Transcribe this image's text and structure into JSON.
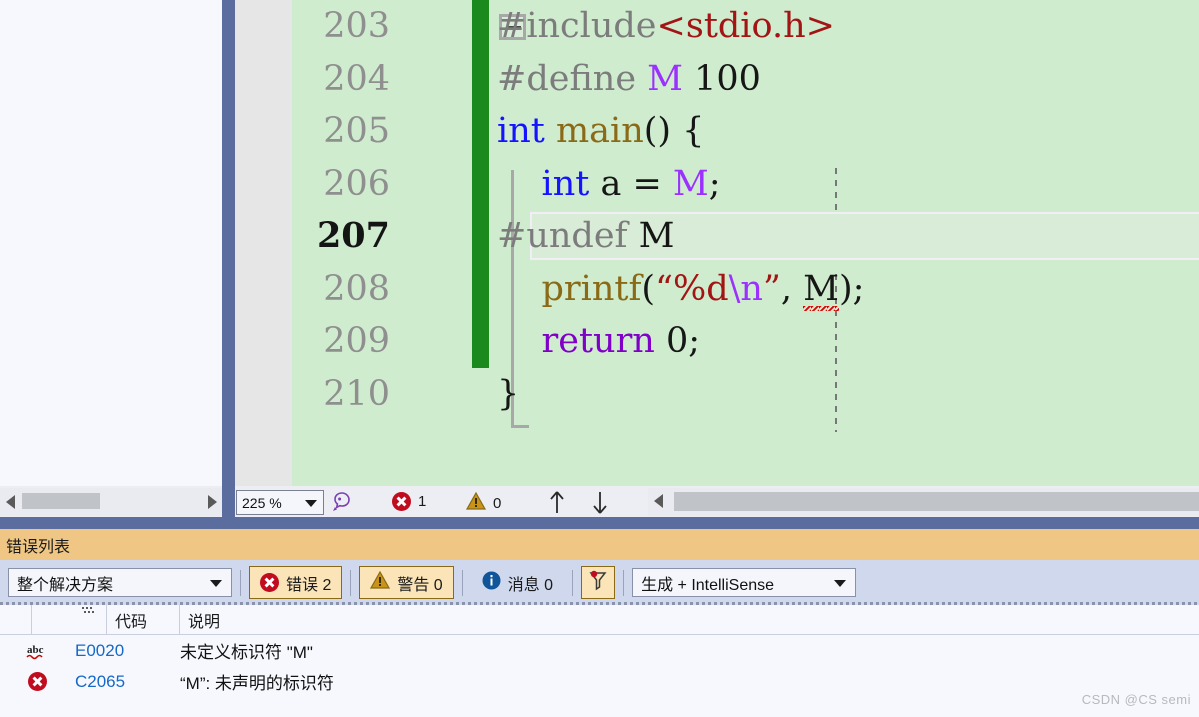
{
  "editor": {
    "zoom_level": "225 %",
    "error_count": "1",
    "warning_count": "0",
    "lines": [
      {
        "num": "203",
        "current": false,
        "tokens": [
          {
            "t": "#include",
            "c": "tok-pp"
          },
          {
            "t": "<stdio.h>",
            "c": "tok-str"
          }
        ]
      },
      {
        "num": "204",
        "current": false,
        "tokens": [
          {
            "t": "#define ",
            "c": "tok-pp"
          },
          {
            "t": "M",
            "c": "tok-macro"
          },
          {
            "t": " 100",
            "c": "tok-plain"
          }
        ]
      },
      {
        "num": "205",
        "current": false,
        "tokens": [
          {
            "t": "int",
            "c": "tok-kw"
          },
          {
            "t": " ",
            "c": "tok-plain"
          },
          {
            "t": "main",
            "c": "tok-fn"
          },
          {
            "t": "() {",
            "c": "tok-plain"
          }
        ]
      },
      {
        "num": "206",
        "current": false,
        "tokens": [
          {
            "t": "    ",
            "c": "tok-plain"
          },
          {
            "t": "int",
            "c": "tok-kw"
          },
          {
            "t": " a = ",
            "c": "tok-plain"
          },
          {
            "t": "M",
            "c": "tok-macro"
          },
          {
            "t": ";",
            "c": "tok-plain"
          }
        ]
      },
      {
        "num": "207",
        "current": true,
        "tokens": [
          {
            "t": "#undef ",
            "c": "tok-pp"
          },
          {
            "t": "M",
            "c": "tok-plain"
          }
        ]
      },
      {
        "num": "208",
        "current": false,
        "tokens": [
          {
            "t": "    ",
            "c": "tok-plain"
          },
          {
            "t": "printf",
            "c": "tok-fn"
          },
          {
            "t": "(",
            "c": "tok-plain"
          },
          {
            "t": "“%d",
            "c": "tok-str"
          },
          {
            "t": "\\n",
            "c": "tok-esc"
          },
          {
            "t": "”",
            "c": "tok-str"
          },
          {
            "t": ", ",
            "c": "tok-plain"
          },
          {
            "t": "M",
            "c": "tok-plain squiggle"
          },
          {
            "t": ");",
            "c": "tok-plain"
          }
        ]
      },
      {
        "num": "209",
        "current": false,
        "tokens": [
          {
            "t": "    ",
            "c": "tok-plain"
          },
          {
            "t": "return",
            "c": "tok-ctl"
          },
          {
            "t": " 0;",
            "c": "tok-plain"
          }
        ]
      },
      {
        "num": "210",
        "current": false,
        "tokens": [
          {
            "t": "}",
            "c": "tok-plain"
          }
        ]
      }
    ]
  },
  "error_list": {
    "title": "错误列表",
    "scope_selected": "整个解决方案",
    "build_filter_selected": "生成 + IntelliSense",
    "errors_label": "错误 2",
    "warnings_label": "警告 0",
    "messages_label": "消息 0",
    "columns": [
      "",
      "",
      "代码",
      "说明"
    ],
    "rows": [
      {
        "icon": "spellcheck-abc-icon",
        "code": "E0020",
        "desc": "未定义标识符 \"M\""
      },
      {
        "icon": "error-circle-icon",
        "code": "C2065",
        "desc": "“M”: 未声明的标识符"
      }
    ]
  },
  "watermark": "CSDN @CS semi",
  "colors": {
    "code_background": "#cfeccf",
    "change_bar": "#1b8a1c",
    "panel_title_bg": "#efc683",
    "toolbar_bg": "#cfd8ec",
    "splitter": "#5b6c9e",
    "error_red": "#c00c1e",
    "warning_amber": "#b8860b",
    "link_blue": "#1569c7"
  }
}
